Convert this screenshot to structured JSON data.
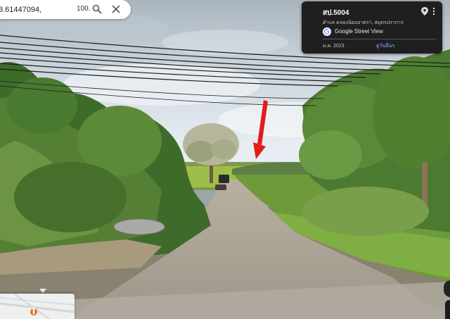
{
  "search": {
    "value": "3.61447094,",
    "suffix": "100."
  },
  "info_card": {
    "title": "สป.5004",
    "subtitle": "ตำบล คลองนิยมยาตรา, สมุทรปราการ",
    "provider": "Google Street View",
    "date": "ม.ค. 2023",
    "more_label": "ดูวันอื่นๆ"
  },
  "icons": {
    "search": "search-icon",
    "close": "close-icon",
    "pin": "location-pin-icon",
    "more": "more-vert-icon",
    "google": "google-g-icon"
  },
  "colors": {
    "annotation_arrow": "#e31b1b",
    "card_bg": "#1f1f1f",
    "link": "#8ab4f8"
  }
}
